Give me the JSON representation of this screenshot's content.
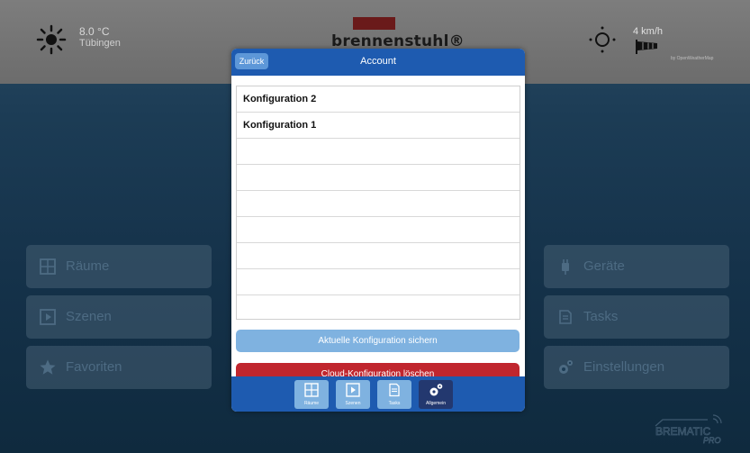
{
  "header": {
    "temperature": "8.0 °C",
    "city": "Tübingen",
    "brand": "brennenstuhl®",
    "wind_speed": "4 km/h",
    "weather_source": "by OpenWeatherMap"
  },
  "tiles": {
    "raeume": "Räume",
    "szenen": "Szenen",
    "favoriten": "Favoriten",
    "geraete": "Geräte",
    "tasks": "Tasks",
    "einstellungen": "Einstellungen"
  },
  "footer_logo": {
    "line1": "BREMATIC",
    "line2": "PRO"
  },
  "modal": {
    "back_label": "Zurück",
    "title": "Account",
    "configurations": [
      "Konfiguration 2",
      "Konfiguration 1",
      "",
      "",
      "",
      "",
      "",
      "",
      ""
    ],
    "save_label": "Aktuelle Konfiguration sichern",
    "delete_label": "Cloud-Konfiguration löschen"
  },
  "nav": {
    "raeume": "Räume",
    "szenen": "Szenen",
    "tasks": "Tasks",
    "allgemein": "Allgemein",
    "active": "allgemein"
  },
  "colors": {
    "header_blue": "#1e5bb0",
    "button_light_blue": "#7fb2e0",
    "delete_red": "#c0262e",
    "nav_active": "#23386f"
  }
}
